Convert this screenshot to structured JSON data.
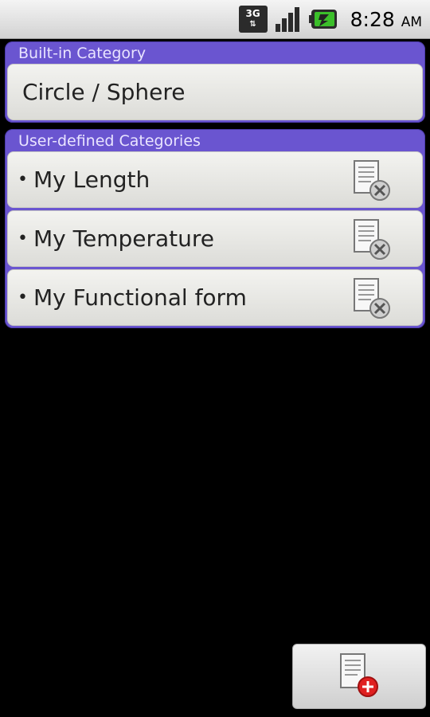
{
  "status_bar": {
    "network_label": "3G",
    "network_icon": "3g-data-icon",
    "signal_icon": "signal-strength-icon",
    "battery_icon": "battery-charging-icon",
    "time": "8:28",
    "ampm": "AM"
  },
  "builtin": {
    "header": "Built-in Category",
    "items": [
      {
        "label": "Circle / Sphere"
      }
    ]
  },
  "user_defined": {
    "header": "User-defined Categories",
    "bullet": "•",
    "items": [
      {
        "label": "My Length",
        "icon": "delete-document-icon"
      },
      {
        "label": "My Temperature",
        "icon": "delete-document-icon"
      },
      {
        "label": "My Functional form",
        "icon": "delete-document-icon"
      }
    ]
  },
  "add_button": {
    "icon": "add-document-icon"
  },
  "colors": {
    "accent": "#6a55d0",
    "item_bg": "#e6e6e2",
    "delete_badge": "#cfcfcf",
    "add_badge": "#e02020"
  }
}
